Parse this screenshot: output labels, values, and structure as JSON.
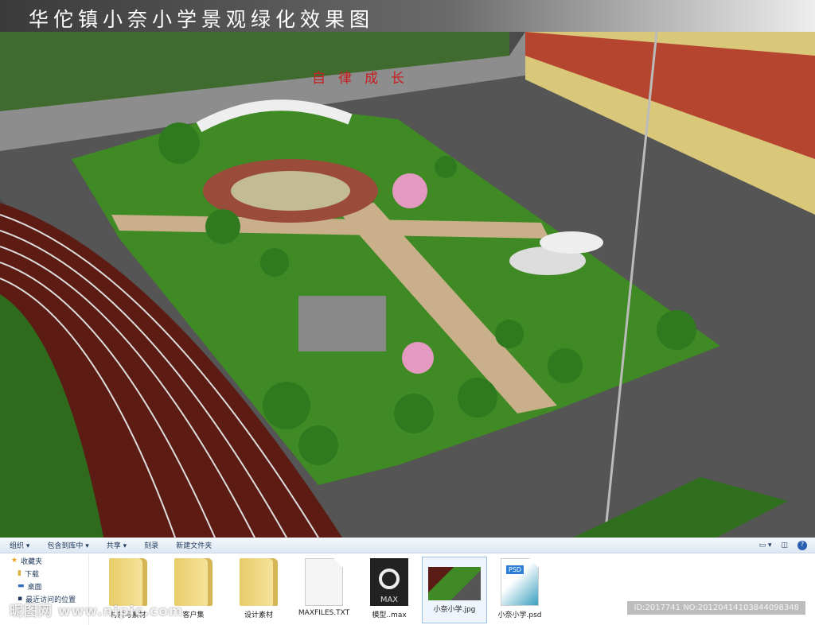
{
  "title": "华佗镇小奈小学景观绿化效果图",
  "wall_slogan": "自律成长",
  "explorer": {
    "toolbar": [
      "组织 ▾",
      "包含到库中 ▾",
      "共享 ▾",
      "刻录",
      "新建文件夹"
    ],
    "sidebar": [
      "收藏夹",
      "下载",
      "桌面",
      "最近访问的位置"
    ],
    "files": [
      {
        "name": "材质与素材",
        "type": "folder"
      },
      {
        "name": "客户集",
        "type": "folder"
      },
      {
        "name": "设计素材",
        "type": "folder"
      },
      {
        "name": "MAXFILES.TXT",
        "type": "txt"
      },
      {
        "name": "模型..max",
        "type": "max",
        "badge": "MAX"
      },
      {
        "name": "小奈小学.jpg",
        "type": "jpg",
        "selected": true
      },
      {
        "name": "小奈小学.psd",
        "type": "psd",
        "badge": "PSD"
      }
    ]
  },
  "watermark": "昵图网 www.nipic.com",
  "image_id": "ID:2017741 NO:20120414103844098348"
}
